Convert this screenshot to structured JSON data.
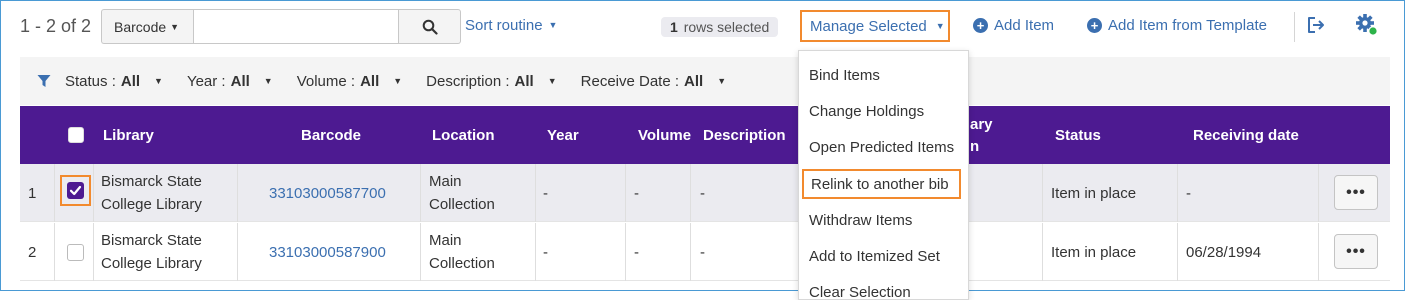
{
  "toolbar": {
    "count": "1 - 2 of 2",
    "search_scope": "Barcode",
    "search_value": "",
    "sort_label": "Sort routine",
    "rows_selected_count": "1",
    "rows_selected_text": "rows selected",
    "manage_selected": "Manage Selected",
    "add_item": "Add Item",
    "add_item_template": "Add Item from Template"
  },
  "filters": [
    {
      "label": "Status :",
      "value": "All"
    },
    {
      "label": "Year :",
      "value": "All"
    },
    {
      "label": "Volume :",
      "value": "All"
    },
    {
      "label": "Description :",
      "value": "All"
    },
    {
      "label": "Receive Date :",
      "value": "All"
    }
  ],
  "table": {
    "headers": {
      "library": "Library",
      "barcode": "Barcode",
      "location": "Location",
      "year": "Year",
      "volume": "Volume",
      "description": "Description",
      "hidden_top": "ary",
      "hidden_bottom": "n",
      "status": "Status",
      "receiving_date": "Receiving date"
    },
    "rows": [
      {
        "num": "1",
        "checked": true,
        "library_line1": "Bismarck State",
        "library_line2": "College Library",
        "barcode": "33103000587700",
        "location_line1": "Main",
        "location_line2": "Collection",
        "year": "-",
        "volume": "-",
        "description": "-",
        "status": "Item in place",
        "receiving_date": "-",
        "more": "•••"
      },
      {
        "num": "2",
        "checked": false,
        "library_line1": "Bismarck State",
        "library_line2": "College Library",
        "barcode": "33103000587900",
        "location_line1": "Main",
        "location_line2": "Collection",
        "year": "-",
        "volume": "-",
        "description": "-",
        "status": "Item in place",
        "receiving_date": "06/28/1994",
        "more": "•••"
      }
    ]
  },
  "menu": {
    "items": [
      "Bind Items",
      "Change Holdings",
      "Open Predicted Items",
      "Relink to another bib",
      "Withdraw Items",
      "Add to Itemized Set",
      "Clear Selection"
    ]
  },
  "colors": {
    "header_purple": "#4d1a91",
    "link_blue": "#3b6fb0",
    "highlight_orange": "#f28a2e",
    "status_green": "#2db34a"
  }
}
